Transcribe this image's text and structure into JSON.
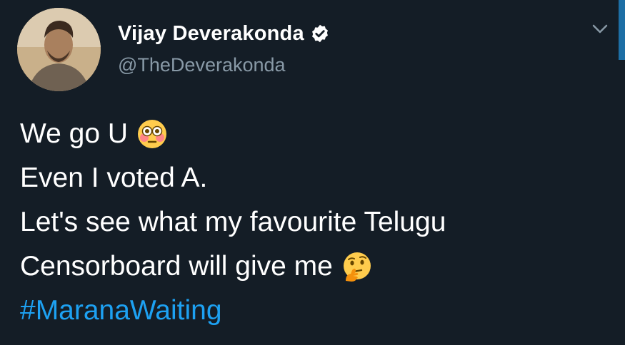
{
  "tweet": {
    "author": {
      "display_name": "Vijay Deverakonda",
      "handle": "@TheDeverakonda",
      "verified": true
    },
    "menu_icon": "chevron-down-icon",
    "lines": [
      {
        "text": "We go U",
        "emoji": "flushed-face-emoji"
      },
      {
        "text": "Even I voted A."
      },
      {
        "text": "Let's see what my favourite Telugu"
      },
      {
        "text": "Censorboard will give me",
        "emoji": "thinking-face-emoji"
      }
    ],
    "hashtag": "#MaranaWaiting"
  },
  "theme": {
    "background": "#141d26",
    "text": "#ffffff",
    "secondary_text": "#8899a6",
    "link": "#1da1f2"
  }
}
